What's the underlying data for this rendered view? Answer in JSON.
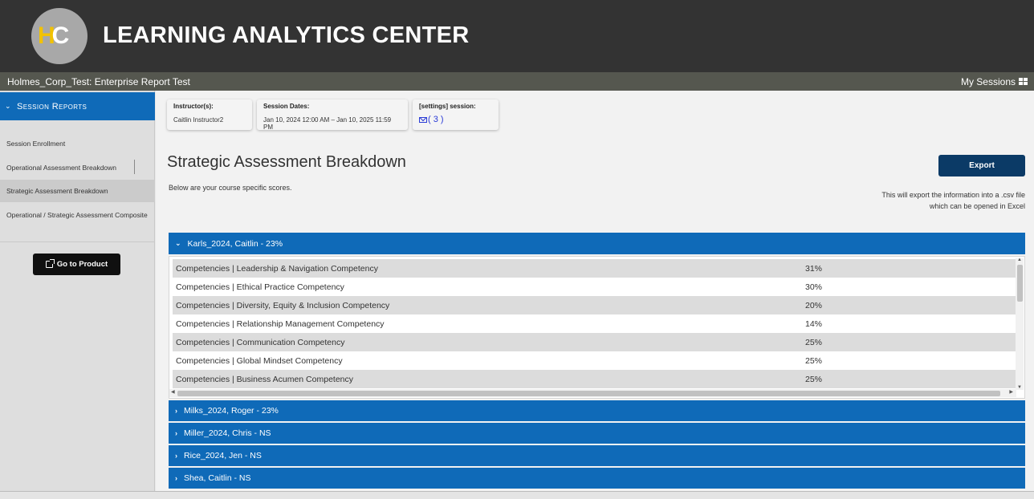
{
  "header": {
    "logo_text_h": "H",
    "logo_text_c": "C",
    "title": "LEARNING ANALYTICS CENTER"
  },
  "subbar": {
    "org": "Holmes_Corp_Test: Enterprise Report Test",
    "my_sessions": "My Sessions"
  },
  "sidebar": {
    "heading": "Session Reports",
    "items": [
      {
        "label": "Session Enrollment"
      },
      {
        "label": "Operational Assessment Breakdown"
      },
      {
        "label": "Strategic Assessment Breakdown"
      },
      {
        "label": "Operational / Strategic Assessment Composite"
      }
    ],
    "go_to_product": "Go to Product"
  },
  "info_cards": {
    "instructors_label": "Instructor(s):",
    "instructors_value": "Caitlin Instructor2",
    "dates_label": "Session Dates:",
    "dates_value": "Jan 10, 2024 12:00 AM – Jan 10, 2025 11:59 PM",
    "session_label": "[settings] session:",
    "session_value": "( 3 )"
  },
  "main": {
    "title": "Strategic Assessment Breakdown",
    "subtitle": "Below are your course specific scores.",
    "export_label": "Export",
    "export_note_line1": "This will export the information into a .csv file",
    "export_note_line2": "which can be opened in Excel"
  },
  "accordion": {
    "expanded": {
      "label": "Karls_2024, Caitlin - 23%",
      "rows": [
        {
          "name": "Competencies | Leadership & Navigation Competency",
          "score": "31%"
        },
        {
          "name": "Competencies | Ethical Practice Competency",
          "score": "30%"
        },
        {
          "name": "Competencies | Diversity, Equity & Inclusion Competency",
          "score": "20%"
        },
        {
          "name": "Competencies | Relationship Management Competency",
          "score": "14%"
        },
        {
          "name": "Competencies | Communication Competency",
          "score": "25%"
        },
        {
          "name": "Competencies | Global Mindset Competency",
          "score": "25%"
        },
        {
          "name": "Competencies | Business Acumen Competency",
          "score": "25%"
        }
      ]
    },
    "collapsed": [
      {
        "label": "Milks_2024, Roger - 23%"
      },
      {
        "label": "Miller_2024, Chris - NS"
      },
      {
        "label": "Rice_2024, Jen - NS"
      },
      {
        "label": "Shea, Caitlin - NS"
      }
    ]
  },
  "colors": {
    "topbar": "#333333",
    "subbar": "#55574f",
    "accent_blue": "#0f6ab8",
    "export_navy": "#0b3a66",
    "logo_yellow": "#f2c200"
  },
  "icons": [
    "grid-icon",
    "chevron-down-icon",
    "chevron-right-icon",
    "external-link-icon",
    "mail-icon"
  ]
}
